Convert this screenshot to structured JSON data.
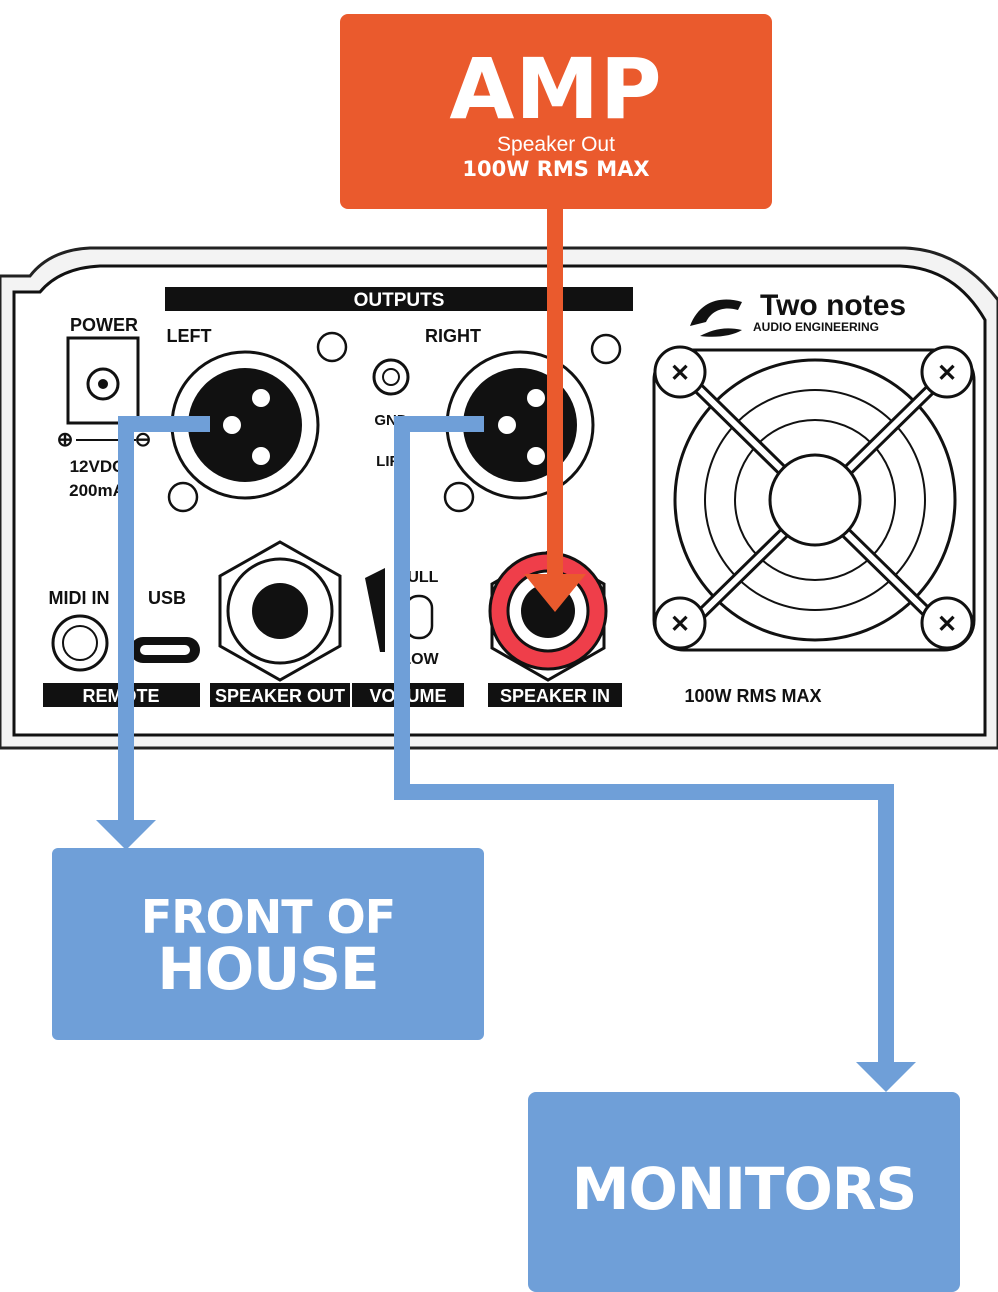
{
  "colors": {
    "amp": "#ea5a2d",
    "destination": "#6f9fd8",
    "cable": "#6f9fd8",
    "speaker_in_ring": "#ef3e4a",
    "panel_line": "#111111"
  },
  "amp": {
    "title": "AMP",
    "subtitle": "Speaker Out",
    "max": "100W RMS MAX"
  },
  "panel": {
    "brand": "Two notes",
    "brand_sub": "AUDIO ENGINEERING",
    "outputs_label": "OUTPUTS",
    "power_label": "POWER",
    "left_label": "LEFT",
    "right_label": "RIGHT",
    "gnd_label": "GND",
    "lift_label": "LIFT",
    "power_spec_1": "12VDC",
    "power_spec_2": "200mA",
    "midi_label": "MIDI IN",
    "usb_label": "USB",
    "remote_label": "REMOTE",
    "speaker_out_label": "SPEAKER OUT",
    "volume_label": "VOLUME",
    "full_label": "FULL",
    "low_label": "LOW",
    "speaker_in_label": "SPEAKER IN",
    "panel_max": "100W RMS MAX",
    "plus_sign": "⊕",
    "minus_sign": "⊖"
  },
  "destinations": {
    "foh_line1": "FRONT OF",
    "foh_line2": "HOUSE",
    "monitors": "MONITORS"
  }
}
